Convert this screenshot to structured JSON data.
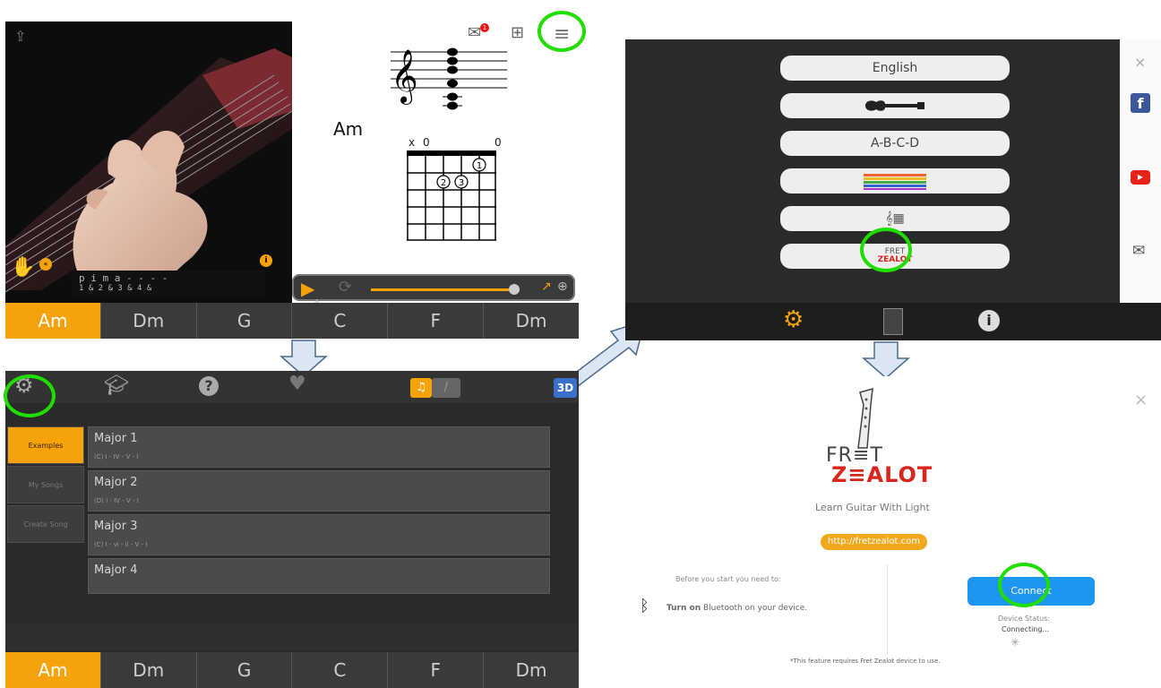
{
  "chord_bar": [
    "Am",
    "Dm",
    "G",
    "C",
    "F",
    "Dm"
  ],
  "chord_name": "Am",
  "chord_diagram": {
    "top_markers": [
      "x",
      "0",
      "0"
    ],
    "fingers": [
      "1",
      "2",
      "3"
    ]
  },
  "tab_row": {
    "fingers": "p  i  m  a  -  -  -  -",
    "counts": "1  &  2  &  3  &  4  &"
  },
  "notification_count": "1",
  "song_list": {
    "side_buttons": [
      "Examples",
      "My Songs",
      "Create Song"
    ],
    "songs": [
      {
        "title": "Major 1",
        "progression": "(C) I - IV - V - I"
      },
      {
        "title": "Major 2",
        "progression": "(D) I - IV - V - I"
      },
      {
        "title": "Major 3",
        "progression": "(C) I - vi - ii - V - I"
      },
      {
        "title": "Major 4",
        "progression": ""
      }
    ],
    "view_toggle": "3D"
  },
  "settings": {
    "buttons": [
      "English",
      "A-B-C-D"
    ],
    "fret_zealot_logo": {
      "line1": "FRET",
      "line2": "ZEALOT"
    }
  },
  "fret_zealot": {
    "logo_line1": "FR≡T",
    "logo_line2": "Z≡ALOT",
    "tagline": "Learn Guitar With Light",
    "url": "http://fretzealot.com",
    "before_text": "Before you start you need to:",
    "turn_on_bold": "Turn on",
    "turn_on_rest": " Bluetooth on your device.",
    "connect_label": "Connect",
    "status_label": "Device Status:",
    "status_value": "Connecting...",
    "footnote": "*This feature requires Fret Zealot device to use.",
    "close": "×"
  },
  "social_close": "×",
  "colors": {
    "accent": "#f5a20b",
    "highlight": "#22dd00",
    "facebook": "#3b5998",
    "youtube": "#e62117",
    "connect": "#1e96ef"
  }
}
